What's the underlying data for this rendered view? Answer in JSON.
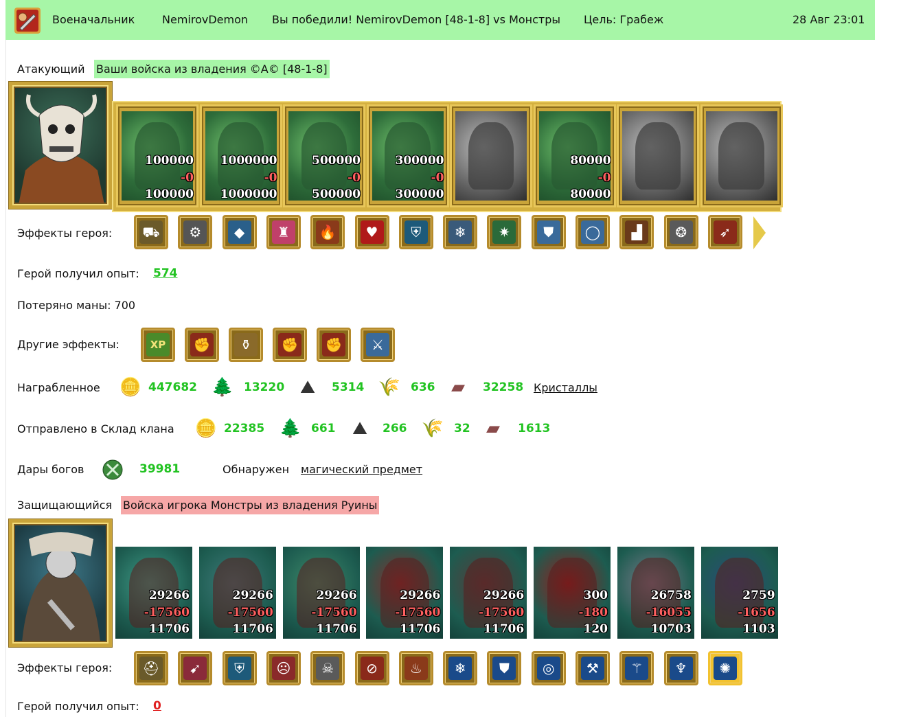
{
  "header": {
    "title": "Военачальник",
    "player": "NemirovDemon",
    "result": "Вы победили! NemirovDemon [48-1-8] vs Монстры",
    "goal": "Цель: Грабеж",
    "datetime": "28 Авг 23:01"
  },
  "attacker": {
    "label": "Атакующий",
    "name": "Ваши войска из владения ©A© [48-1-8]",
    "units": [
      {
        "icon": "dwarf-unit-icon",
        "start": "100000",
        "loss": "-0",
        "end": "100000",
        "alive": true
      },
      {
        "icon": "knight-unit-icon",
        "start": "1000000",
        "loss": "-0",
        "end": "1000000",
        "alive": true
      },
      {
        "icon": "spearman-unit-icon",
        "start": "500000",
        "loss": "-0",
        "end": "500000",
        "alive": true
      },
      {
        "icon": "griffin-unit-icon",
        "start": "300000",
        "loss": "-0",
        "end": "300000",
        "alive": true
      },
      {
        "icon": "archer-unit-icon",
        "start": "",
        "loss": "",
        "end": "",
        "alive": false
      },
      {
        "icon": "elf-unit-icon",
        "start": "80000",
        "loss": "-0",
        "end": "80000",
        "alive": true
      },
      {
        "icon": "hooded-warrior-unit-icon",
        "start": "",
        "loss": "",
        "end": "",
        "alive": false
      },
      {
        "icon": "monk-unit-icon",
        "start": "",
        "loss": "",
        "end": "",
        "alive": false
      }
    ],
    "effects_label": "Эффекты героя:",
    "effects": [
      "cart-icon",
      "gear-icon",
      "blue-gem-icon",
      "pink-castle-icon",
      "fire-chest-icon",
      "heart-icon",
      "shield-icon",
      "snowflake-icon",
      "compass-icon",
      "armor-icon",
      "ring-icon",
      "boots-icon",
      "amulet-icon",
      "bow-icon"
    ],
    "xp_label": "Герой получил опыт:",
    "xp_value": "574",
    "mana_label": "Потеряно маны: 700",
    "other_label": "Другие эффекты:",
    "other_effects": [
      "xp-icon",
      "fist-sword-icon",
      "scroll-gold-icon",
      "fist-sword-icon",
      "fist-sword-icon",
      "sword-icon"
    ],
    "loot_label": "Награбленное",
    "loot": [
      {
        "icon": "gold-icon",
        "value": "447682"
      },
      {
        "icon": "wood-icon",
        "value": "13220"
      },
      {
        "icon": "ore-icon",
        "value": "5314"
      },
      {
        "icon": "wheat-icon",
        "value": "636"
      },
      {
        "icon": "stone-icon",
        "value": "32258"
      }
    ],
    "loot_link": "Кристаллы",
    "clan_label": "Отправлено в Склад клана",
    "clan": [
      {
        "icon": "gold-icon",
        "value": "22385"
      },
      {
        "icon": "wood-icon",
        "value": "661"
      },
      {
        "icon": "ore-icon",
        "value": "266"
      },
      {
        "icon": "wheat-icon",
        "value": "32"
      },
      {
        "icon": "stone-icon",
        "value": "1613"
      }
    ],
    "gifts_label": "Дары богов",
    "gifts_value": "39981",
    "found_label": "Обнаружен",
    "found_link": "магический предмет"
  },
  "defender": {
    "label": "Защищающийся",
    "name": "Войска игрока Монстры из владения Руины",
    "units": [
      {
        "icon": "scorpion-unit-icon",
        "start": "29266",
        "loss": "-17560",
        "end": "11706"
      },
      {
        "icon": "golem-unit-icon",
        "start": "29266",
        "loss": "-17560",
        "end": "11706"
      },
      {
        "icon": "orc-unit-icon",
        "start": "29266",
        "loss": "-17560",
        "end": "11706"
      },
      {
        "icon": "demon-unit-icon",
        "start": "29266",
        "loss": "-17560",
        "end": "11706"
      },
      {
        "icon": "spider-unit-icon",
        "start": "29266",
        "loss": "-17560",
        "end": "11706"
      },
      {
        "icon": "ghoul-unit-icon",
        "start": "300",
        "loss": "-180",
        "end": "120"
      },
      {
        "icon": "tower-beast-unit-icon",
        "start": "26758",
        "loss": "-16055",
        "end": "10703"
      },
      {
        "icon": "serpent-unit-icon",
        "start": "2759",
        "loss": "-1656",
        "end": "1103"
      }
    ],
    "effects_label": "Эффекты героя:",
    "effects": [
      "helmet-icon",
      "arrows-icon",
      "shield-icon",
      "berserker-icon",
      "skull-icon",
      "no-hammer-icon",
      "fire-head-icon",
      "frost-armor-icon",
      "frost-mail-icon",
      "frost-ring-icon",
      "frost-axe-icon",
      "frost-staff-icon",
      "frost-trident-icon",
      "frost-spider-icon"
    ],
    "xp_label": "Герой получил опыт:",
    "xp_value": "0"
  },
  "colors": {
    "header_bg": "#a7f6a7",
    "attacker_bg": "#a7f6a7",
    "defender_bg": "#f6a7a7",
    "value_green": "#22c322",
    "value_red": "#e02020"
  }
}
